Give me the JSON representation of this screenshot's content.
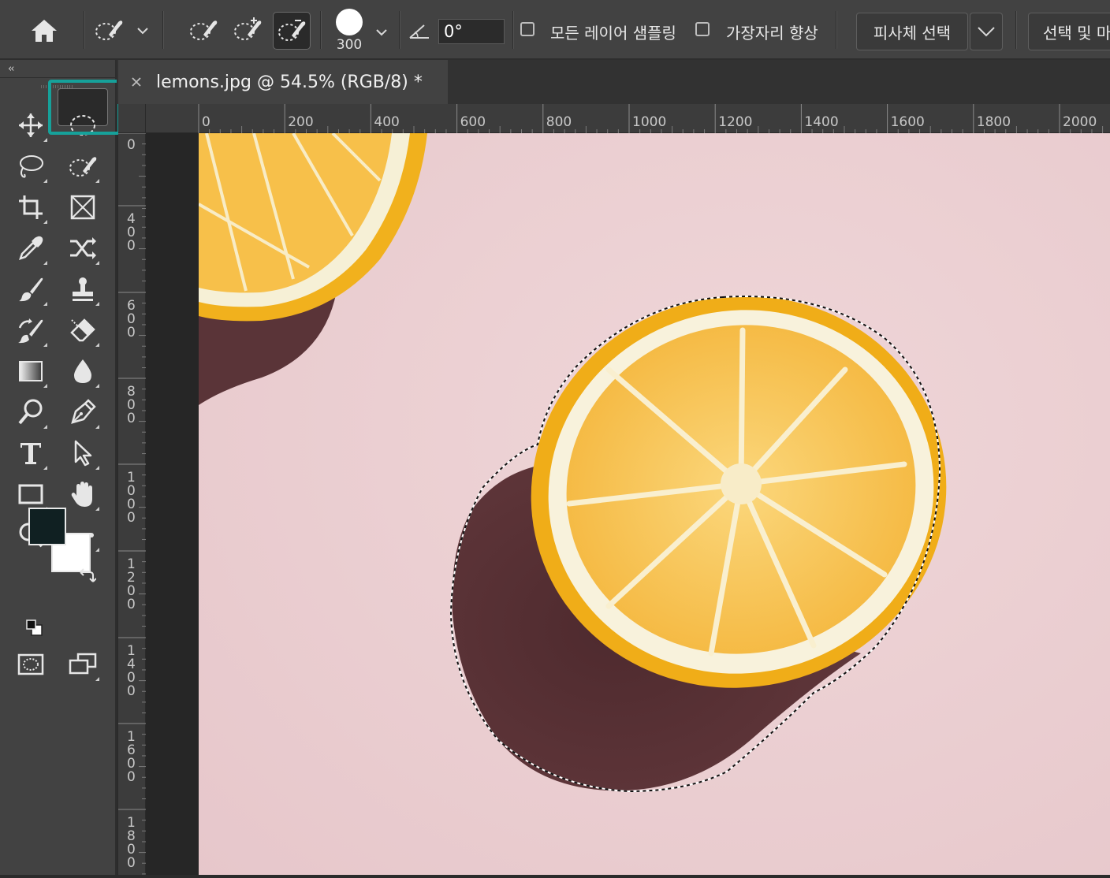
{
  "options_bar": {
    "home": "home-icon",
    "brush_size": "300",
    "angle": "0°",
    "sample_all_layers_label": "모든 레이어 샘플링",
    "enhance_edge_label": "가장자리 향상",
    "select_subject_label": "피사체 선택",
    "select_and_mask_label": "선택 및 마"
  },
  "toolbar": {
    "collapse": "‹‹",
    "tools": [
      "move-tool",
      "marquee-tool",
      "lasso-tool",
      "quick-selection-tool",
      "crop-tool",
      "frame-tool",
      "eyedropper-tool",
      "content-aware-move-tool",
      "brush-tool",
      "clone-stamp-tool",
      "history-brush-tool",
      "eraser-tool",
      "gradient-tool",
      "blur-tool",
      "dodge-tool",
      "pen-tool",
      "type-tool",
      "path-selection-tool",
      "rectangle-tool",
      "hand-tool",
      "zoom-tool",
      "more-tools",
      "quick-mask-mode",
      "screen-mode"
    ],
    "active_tool": "quick-selection-tool",
    "highlight_color": "#16a19a",
    "foreground_color": "#102022",
    "background_color": "#ffffff"
  },
  "document": {
    "tab_title": "lemons.jpg @ 54.5% (RGB/8) *"
  },
  "rulers": {
    "horizontal": [
      "0",
      "200",
      "400",
      "600",
      "800",
      "1000",
      "1200",
      "1400",
      "1600",
      "1800",
      "2000"
    ],
    "vertical": [
      "0",
      "400",
      "600",
      "800",
      "1000",
      "1200",
      "1400",
      "1600",
      "1800"
    ]
  },
  "canvas": {
    "background_color": "#ebcfd2",
    "lemon_peel": "#f2b21c",
    "lemon_flesh": "#f6bf47",
    "shadow_color": "#5a3236"
  }
}
